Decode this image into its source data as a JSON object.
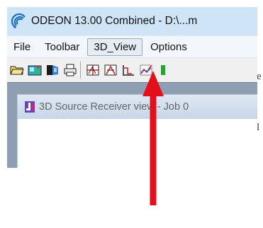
{
  "surrounding": {
    "fragment_top": "e",
    "fragment_bottom": "l"
  },
  "window": {
    "title": "ODEON 13.00 Combined  -  D:\\...m"
  },
  "menubar": {
    "items": [
      {
        "label": "File"
      },
      {
        "label": "Toolbar"
      },
      {
        "label": "3D_View",
        "state": "hover"
      },
      {
        "label": "Options"
      }
    ]
  },
  "toolbar": {
    "buttons": [
      "folder-open-icon",
      "library-icon",
      "room-icon",
      "print-icon",
      "grid-view-icon",
      "3d-view-icon",
      "plot-icon",
      "graph-icon",
      "green-marker-icon"
    ]
  },
  "child_window": {
    "title": "3D Source Receiver view - Job 0"
  },
  "annotation": {
    "arrow_color": "#e3101c",
    "points_to": "3D_View"
  },
  "colors": {
    "title_bar": "#cfe4f7",
    "mdi_background": "#8e9fb3",
    "arrow": "#e3101c"
  }
}
